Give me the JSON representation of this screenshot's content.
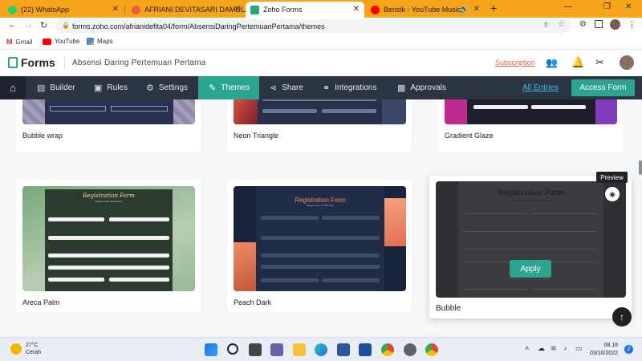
{
  "browser": {
    "tabs": [
      {
        "title": "(22) WhatsApp",
        "color": "#25d366"
      },
      {
        "title": "AFRIANI DEVITASARI DAMULAWA",
        "color": "#e8603c"
      },
      {
        "title": "Zoho Forms",
        "color": "#2aa77a"
      },
      {
        "title": "Berisik - YouTube Music",
        "color": "#ff0000"
      }
    ],
    "new_tab": "+",
    "url": "forms.zoho.com/afrianidefita04/form/AbsensiDaringPertemuanPertama/themes",
    "bookmarks": [
      "Gmail",
      "YouTube",
      "Maps"
    ]
  },
  "header": {
    "app_name": "Forms",
    "form_title": "Absensi Daring Pertemuan Pertama",
    "subscription": "Subscription"
  },
  "nav": {
    "items": [
      "Builder",
      "Rules",
      "Settings",
      "Themes",
      "Share",
      "Integrations",
      "Approvals"
    ],
    "all_entries": "All Entries",
    "access_form": "Access Form"
  },
  "themes": {
    "row1": [
      "Bubble wrap",
      "Neon Triangle",
      "Gradient Glaze"
    ],
    "row2": [
      "Areca Palm",
      "Peach Dark",
      "Bubble"
    ],
    "thumb_title": "Registration Form",
    "thumb_subtitle": "Register your details here",
    "preview_tooltip": "Preview",
    "apply_label": "Apply"
  },
  "taskbar": {
    "temperature": "27°C",
    "condition": "Cerah",
    "time": "08.18",
    "date": "03/10/2022",
    "notifications": "2"
  },
  "colors": {
    "accent": "#2ba58f",
    "navbar": "#2b3441",
    "tabstrip": "#f7a41d"
  }
}
